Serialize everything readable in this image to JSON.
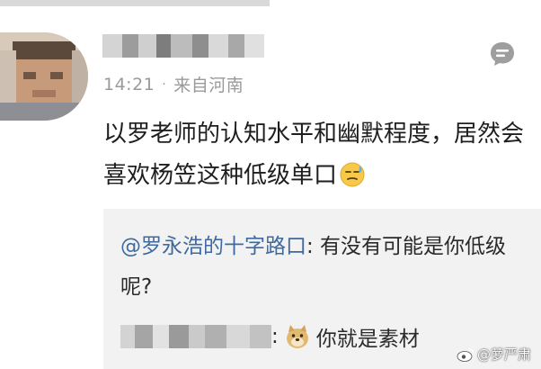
{
  "post": {
    "time": "14:21",
    "separator": "·",
    "location": "来自河南",
    "content": "以罗老师的认知水平和幽默程度，居然会喜欢杨笠这种低级单口",
    "content_emoji": "sweat-emoji"
  },
  "quote": {
    "mention": "@罗永浩的十字路口",
    "text": ": 有没有可能是你低级呢?",
    "reply_colon": ":",
    "reply_emoji": "doge-emoji",
    "reply_text": "你就是素材"
  },
  "watermark": {
    "text": "@萝严肃"
  },
  "colors": {
    "mention": "#3e6aa1",
    "meta": "#9a9a9a",
    "quote_bg": "#f2f2f2"
  }
}
